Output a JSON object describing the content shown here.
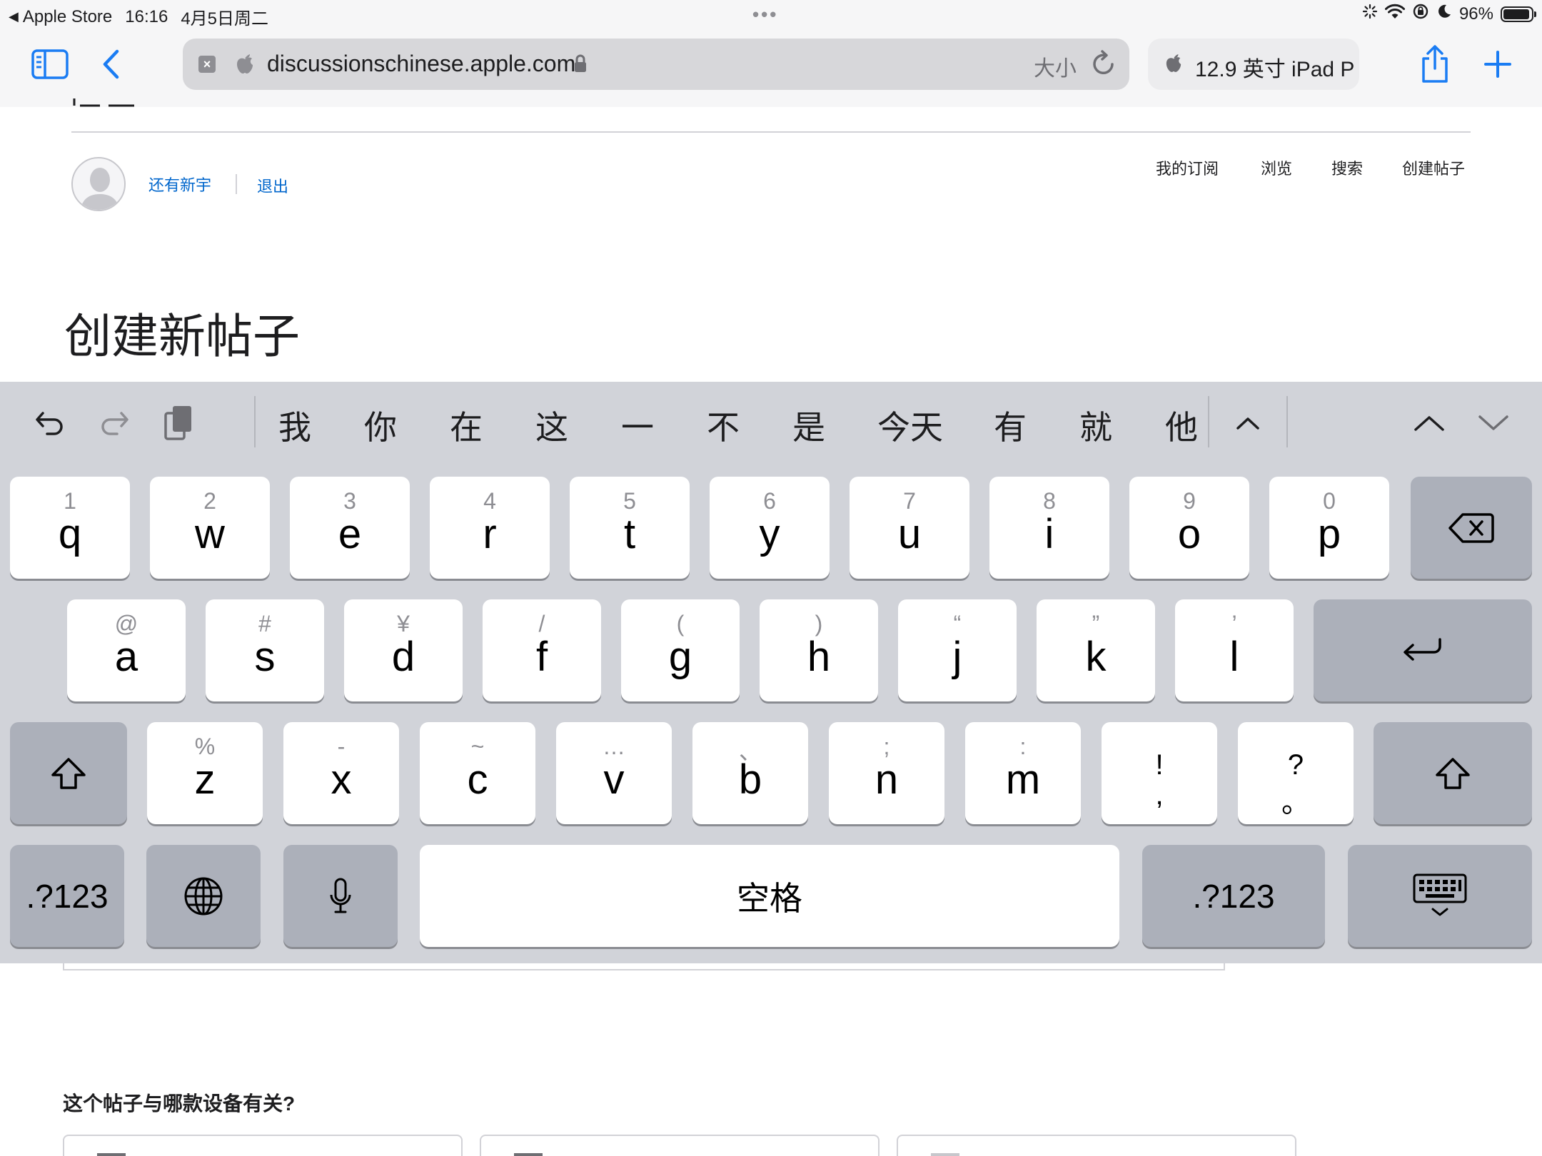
{
  "status_bar": {
    "back_app": "Apple Store",
    "time": "16:16",
    "date": "4月5日周二",
    "battery": "96%",
    "battery_level": 0.96
  },
  "browser": {
    "url": "discussionschinese.apple.com",
    "text_size_label": "大小",
    "other_tab_title": "12.9 英寸 iPad P",
    "icons": [
      "sidebar-icon",
      "back-icon",
      "close-icon",
      "apple-icon",
      "lock-icon",
      "reload-icon",
      "share-icon",
      "plus-icon"
    ]
  },
  "page": {
    "username": "还有新宇",
    "logout": "退出",
    "nav": [
      "我的订阅",
      "浏览",
      "搜索",
      "创建帖子"
    ],
    "title": "创建新帖子",
    "device_question": "这个帖子与哪款设备有关?"
  },
  "keyboard": {
    "candidates": [
      "我",
      "你",
      "在",
      "这",
      "一",
      "不",
      "是",
      "今天",
      "有",
      "就",
      "他"
    ],
    "rows": [
      [
        {
          "hint": "1",
          "label": "q"
        },
        {
          "hint": "2",
          "label": "w"
        },
        {
          "hint": "3",
          "label": "e"
        },
        {
          "hint": "4",
          "label": "r"
        },
        {
          "hint": "5",
          "label": "t"
        },
        {
          "hint": "6",
          "label": "y"
        },
        {
          "hint": "7",
          "label": "u"
        },
        {
          "hint": "8",
          "label": "i"
        },
        {
          "hint": "9",
          "label": "o"
        },
        {
          "hint": "0",
          "label": "p"
        }
      ],
      [
        {
          "hint": "@",
          "label": "a"
        },
        {
          "hint": "#",
          "label": "s"
        },
        {
          "hint": "¥",
          "label": "d"
        },
        {
          "hint": "/",
          "label": "f"
        },
        {
          "hint": "(",
          "label": "g"
        },
        {
          "hint": ")",
          "label": "h"
        },
        {
          "hint": "“",
          "label": "j"
        },
        {
          "hint": "”",
          "label": "k"
        },
        {
          "hint": "’",
          "label": "l"
        }
      ],
      [
        {
          "hint": "%",
          "label": "z"
        },
        {
          "hint": "-",
          "label": "x"
        },
        {
          "hint": "~",
          "label": "c"
        },
        {
          "hint": "…",
          "label": "v"
        },
        {
          "hint": "、",
          "label": "b"
        },
        {
          "hint": ";",
          "label": "n"
        },
        {
          "hint": ":",
          "label": "m"
        }
      ]
    ],
    "punct_keys": [
      {
        "top": "!",
        "bottom": ","
      },
      {
        "top": "?",
        "bottom": "。"
      }
    ],
    "symbols_label": ".?123",
    "space_label": "空格"
  }
}
